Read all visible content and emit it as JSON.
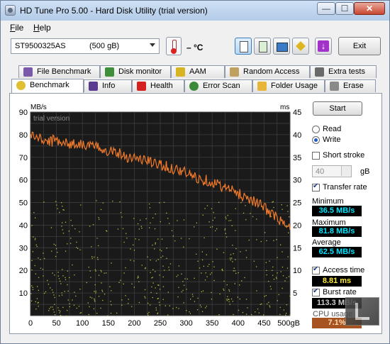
{
  "window": {
    "title": "HD Tune Pro 5.00 - Hard Disk Utility (trial version)",
    "min_glyph": "—",
    "max_glyph": "☐",
    "close_glyph": "✕"
  },
  "menu": {
    "file_key": "F",
    "file_rest": "ile",
    "help_key": "H",
    "help_rest": "elp"
  },
  "toolbar": {
    "drive_name": "ST9500325AS",
    "drive_size": "(500 gB)",
    "temperature": "– °C",
    "exit_label": "Exit"
  },
  "tabs_top": [
    {
      "label": "File Benchmark",
      "icon": "file-benchmark-icon",
      "color": "#7a5aa8"
    },
    {
      "label": "Disk monitor",
      "icon": "disk-monitor-icon",
      "color": "#3f8f3a"
    },
    {
      "label": "AAM",
      "icon": "speaker-icon",
      "color": "#d7b421"
    },
    {
      "label": "Random Access",
      "icon": "random-access-icon",
      "color": "#c0a060"
    },
    {
      "label": "Extra tests",
      "icon": "extra-tests-icon",
      "color": "#6a6a6a"
    }
  ],
  "tabs_bottom": [
    {
      "label": "Benchmark",
      "icon": "benchmark-icon",
      "color": "#e0c030",
      "active": true
    },
    {
      "label": "Info",
      "icon": "info-icon",
      "color": "#5b3a92"
    },
    {
      "label": "Health",
      "icon": "health-cross-icon",
      "color": "#d42020"
    },
    {
      "label": "Error Scan",
      "icon": "magnifier-icon",
      "color": "#3a8a3a"
    },
    {
      "label": "Folder Usage",
      "icon": "folder-icon",
      "color": "#e6b53a"
    },
    {
      "label": "Erase",
      "icon": "trash-icon",
      "color": "#8a8a8a"
    }
  ],
  "controls": {
    "start_label": "Start",
    "read_label": "Read",
    "write_label": "Write",
    "mode": "Write",
    "short_stroke_label": "Short stroke",
    "short_stroke_checked": false,
    "stroke_value": "40",
    "stroke_unit": "gB",
    "transfer_rate_label": "Transfer rate",
    "transfer_rate_checked": true,
    "access_time_label": "Access time",
    "access_time_checked": true,
    "burst_rate_label": "Burst rate",
    "burst_rate_checked": true
  },
  "stats": {
    "minimum_label": "Minimum",
    "minimum_value": "36.5 MB/s",
    "maximum_label": "Maximum",
    "maximum_value": "81.8 MB/s",
    "average_label": "Average",
    "average_value": "62.5 MB/s",
    "access_value": "8.81 ms",
    "burst_value": "113.3 MB/s",
    "cpu_label": "CPU usage",
    "cpu_value": "7.1%"
  },
  "chart_data": {
    "type": "line",
    "watermark": "trial version",
    "y_left_unit": "MB/s",
    "y_right_unit": "ms",
    "x_unit": "gB",
    "x_ticks": [
      "0",
      "50",
      "100",
      "150",
      "200",
      "250",
      "300",
      "350",
      "400",
      "450",
      "500gB"
    ],
    "y_left_ticks": [
      "10",
      "20",
      "30",
      "40",
      "50",
      "60",
      "70",
      "80",
      "90"
    ],
    "y_right_ticks": [
      "5",
      "10",
      "15",
      "20",
      "25",
      "30",
      "35",
      "40",
      "45"
    ],
    "xlim": [
      0,
      500
    ],
    "ylim_left": [
      0,
      90
    ],
    "ylim_right": [
      0,
      45
    ],
    "background": "#1a1a1a",
    "line_color": "#f07a2a",
    "dot_color": "#d8d84a",
    "series": [
      {
        "x": [
          0,
          10,
          20,
          30,
          40,
          50,
          60,
          70,
          80,
          90,
          100,
          110,
          120,
          130,
          140,
          150,
          160,
          170,
          180,
          190,
          200,
          210,
          220,
          230,
          240,
          250,
          260,
          270,
          280,
          290,
          300,
          310,
          320,
          330,
          340,
          350,
          360,
          370,
          380,
          390,
          400,
          410,
          420,
          430,
          440,
          450,
          460,
          470,
          480,
          490,
          500
        ],
        "values": [
          80,
          79,
          78,
          77,
          77,
          78,
          77,
          76,
          76,
          76,
          76,
          75,
          75,
          74,
          74,
          73,
          73,
          72,
          71,
          70,
          70,
          69,
          69,
          68,
          67,
          67,
          66,
          65,
          65,
          64,
          63,
          62,
          61,
          60,
          60,
          59,
          58,
          57,
          56,
          55,
          54,
          53,
          52,
          51,
          49,
          48,
          46,
          44,
          42,
          40,
          38
        ]
      }
    ]
  }
}
